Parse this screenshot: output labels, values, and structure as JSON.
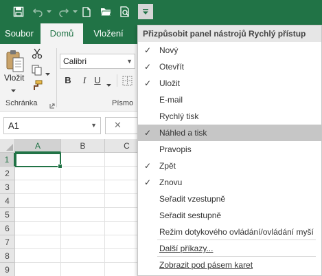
{
  "colors": {
    "accent": "#217346",
    "ribbon_bg": "#f3f3f3",
    "menu_highlight": "#c6c6c6"
  },
  "qat": {
    "icons": [
      "save-icon",
      "undo-icon",
      "redo-icon",
      "new-icon",
      "open-icon",
      "print-preview-icon",
      "customize-qat-icon"
    ]
  },
  "tabs": [
    "Soubor",
    "Domů",
    "Vložení"
  ],
  "ribbon": {
    "paste_label": "Vložit",
    "clipboard_group": "Schránka",
    "font_group": "Písmo",
    "font_name": "Calibri",
    "bold": "B",
    "italic": "I",
    "underline": "U"
  },
  "formula_bar": {
    "name_box": "A1",
    "cancel_glyph": "✕"
  },
  "grid": {
    "columns": [
      "A",
      "B",
      "C"
    ],
    "rows": [
      "1",
      "2",
      "3",
      "4",
      "5",
      "6",
      "7",
      "8",
      "9"
    ],
    "selected_cell": "A1"
  },
  "menu": {
    "title": "Přizpůsobit panel nástrojů Rychlý přístup",
    "items": [
      {
        "label": "Nový",
        "checked": true,
        "mark": "✓"
      },
      {
        "label": "Otevřít",
        "checked": true,
        "mark": "✓"
      },
      {
        "label": "Uložit",
        "checked": true,
        "mark": "✓"
      },
      {
        "label": "E-mail",
        "checked": false,
        "mark": ""
      },
      {
        "label": "Rychlý tisk",
        "checked": false,
        "mark": ""
      },
      {
        "label": "Náhled a tisk",
        "checked": true,
        "mark": "✓",
        "highlighted": true
      },
      {
        "label": "Pravopis",
        "checked": false,
        "mark": ""
      },
      {
        "label": "Zpět",
        "checked": true,
        "mark": "✓"
      },
      {
        "label": "Znovu",
        "checked": true,
        "mark": "✓"
      },
      {
        "label": "Seřadit vzestupně",
        "checked": false,
        "mark": ""
      },
      {
        "label": "Seřadit sestupně",
        "checked": false,
        "mark": ""
      },
      {
        "label": "Režim dotykového ovládání/ovládání myší",
        "checked": false,
        "mark": ""
      },
      {
        "label": "Další příkazy...",
        "checked": false,
        "mark": ""
      },
      {
        "label": "Zobrazit pod pásem karet",
        "checked": false,
        "mark": ""
      }
    ]
  }
}
